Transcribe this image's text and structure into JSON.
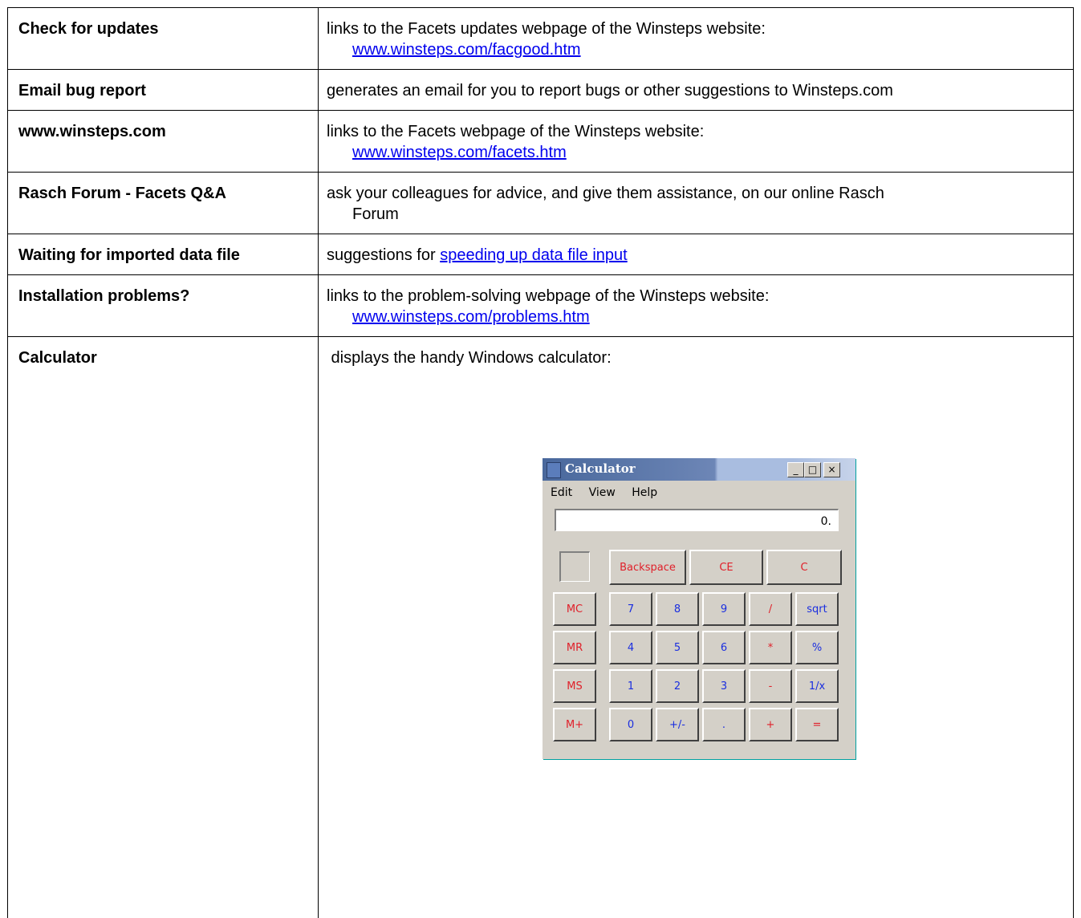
{
  "rows": [
    {
      "term": "Check for updates",
      "desc": "links to the Facets updates webpage of the Winsteps website:",
      "link": "www.winsteps.com/facgood.htm"
    },
    {
      "term": "Email bug report",
      "desc": "generates an email for you to report bugs or other suggestions to Winsteps.com"
    },
    {
      "term": "www.winsteps.com",
      "desc": "links to the Facets webpage of the Winsteps website:",
      "link": "www.winsteps.com/facets.htm"
    },
    {
      "term": "Rasch Forum - Facets Q&A",
      "desc": "ask your colleagues for advice, and give them assistance, on our online Rasch",
      "desc_cont": "Forum"
    },
    {
      "term": "Waiting for imported data file",
      "desc": "suggestions for ",
      "link": "speeding up data file input"
    },
    {
      "term": "Installation problems?",
      "desc": "links to the problem-solving webpage of the Winsteps website:",
      "link": "www.winsteps.com/problems.htm"
    },
    {
      "term": "Calculator",
      "desc": " displays the handy Windows calculator:"
    }
  ],
  "calculator": {
    "title": "Calculator",
    "window_buttons": [
      "_",
      "□",
      "×"
    ],
    "menu": [
      "Edit",
      "View",
      "Help"
    ],
    "display": "0.",
    "top_buttons": [
      "Backspace",
      "CE",
      "C"
    ],
    "memory_buttons": [
      "MC",
      "MR",
      "MS",
      "M+"
    ],
    "grid": [
      [
        "7",
        "8",
        "9",
        "/",
        "sqrt"
      ],
      [
        "4",
        "5",
        "6",
        "*",
        "%"
      ],
      [
        "1",
        "2",
        "3",
        "-",
        "1/x"
      ],
      [
        "0",
        "+/-",
        ".",
        "+",
        "="
      ]
    ],
    "colors": {
      "red": "#e0202a",
      "blue": "#1a2ee0",
      "face": "#d4d0c8",
      "title": "#49689c"
    }
  }
}
